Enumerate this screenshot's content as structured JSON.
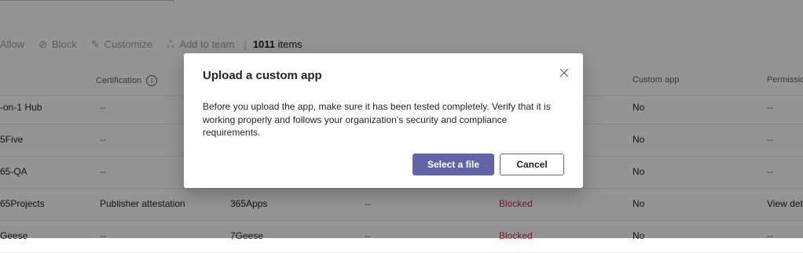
{
  "toolbar": {
    "allow_label": "Allow",
    "block_label": "Block",
    "customize_label": "Customize",
    "add_to_team_label": "Add to team",
    "separator": "|",
    "count_number": "1011",
    "count_suffix": " items"
  },
  "table": {
    "headers": {
      "certification": "Certification",
      "custom_app": "Custom app",
      "permissions": "Permission"
    },
    "rows": [
      {
        "name": "-on-1 Hub",
        "certification": "--",
        "custom_app": "No",
        "permissions": "--"
      },
      {
        "name": "5Five",
        "certification": "--",
        "custom_app": "No",
        "permissions": "--"
      },
      {
        "name": "65-QA",
        "certification": "--",
        "custom_app": "No",
        "permissions": "--"
      },
      {
        "name": "65Projects",
        "certification": "Publisher attestation",
        "publisher": "365Apps",
        "col4": "--",
        "status": "Blocked",
        "custom_app": "No",
        "permissions": "View det"
      },
      {
        "name": "Geese",
        "certification": "--",
        "publisher": "7Geese",
        "col4": "--",
        "status": "Blocked",
        "custom_app": "No",
        "permissions": "--"
      }
    ]
  },
  "dialog": {
    "title": "Upload a custom app",
    "body": "Before you upload the app, make sure it has been tested completely. Verify that it is working properly and follows your organization’s security and compliance requirements.",
    "primary_button": "Select a file",
    "secondary_button": "Cancel"
  },
  "colors": {
    "accent": "#6264a7",
    "blocked": "#c4314b"
  }
}
